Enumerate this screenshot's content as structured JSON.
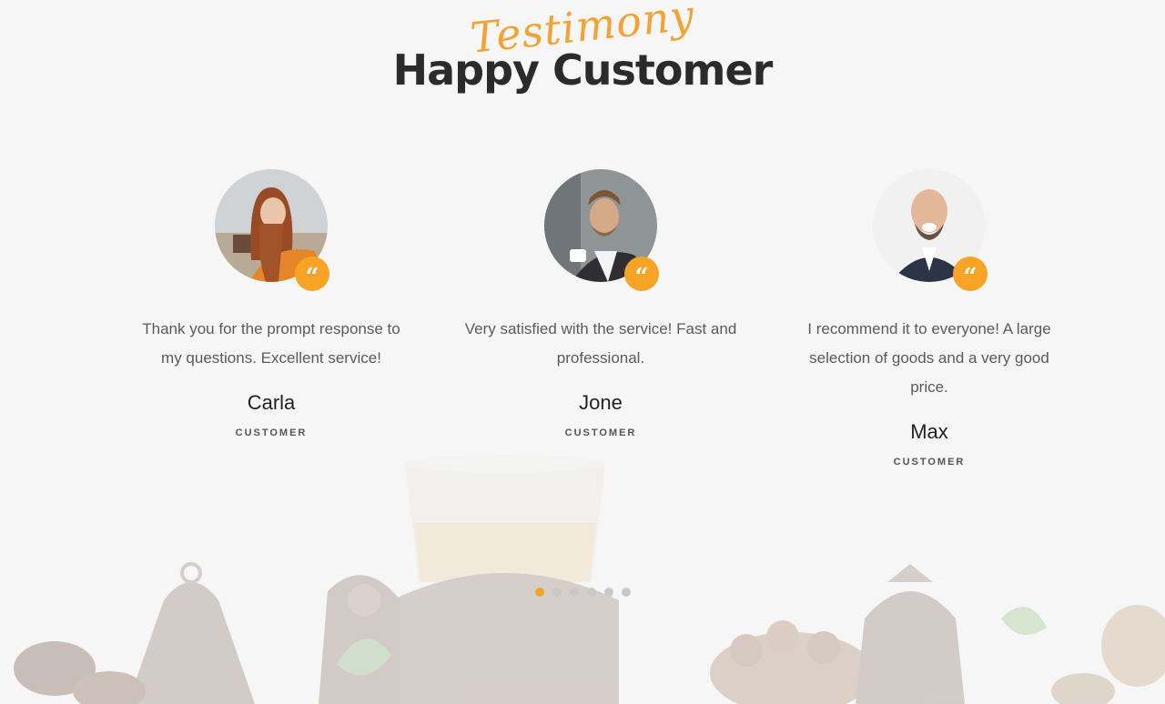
{
  "header": {
    "script_title": "Testimony",
    "main_title": "Happy Customer"
  },
  "testimonials": [
    {
      "text": "Thank you for the prompt response to my questions. Excellent service!",
      "name": "Carla",
      "role": "CUSTOMER",
      "avatar": "woman-portrait"
    },
    {
      "text": "Very satisfied with the service! Fast and professional.",
      "name": "Jone",
      "role": "CUSTOMER",
      "avatar": "man-with-cup-portrait"
    },
    {
      "text": "I recommend it to everyone! A large selection of goods and a very good price.",
      "name": "Max",
      "role": "CUSTOMER",
      "avatar": "bald-man-portrait"
    }
  ],
  "quote_icon": "“",
  "pagination": {
    "count": 6,
    "active": 0
  },
  "colors": {
    "accent": "#f7a325",
    "title": "#2b2b2b",
    "text": "#5a5a5a"
  }
}
